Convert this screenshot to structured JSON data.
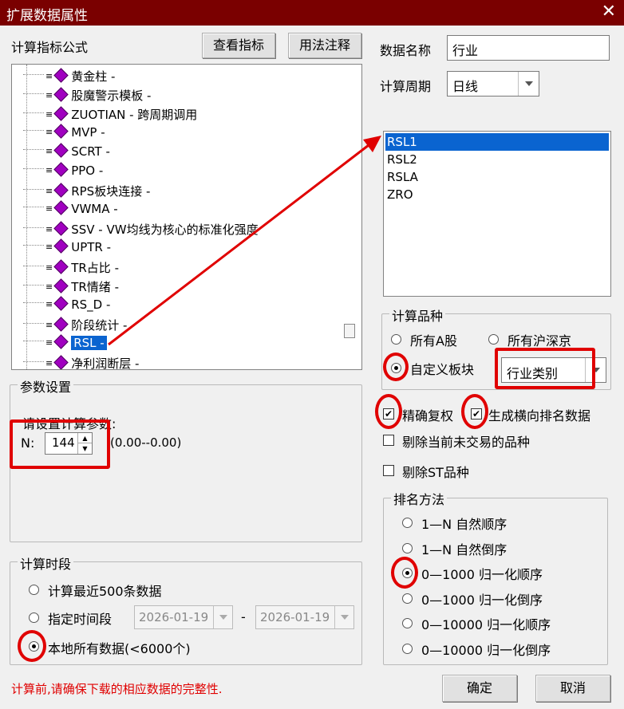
{
  "window": {
    "title": "扩展数据属性",
    "close_glyph": "✕"
  },
  "left": {
    "formula_label": "计算指标公式",
    "view_btn": "查看指标",
    "usage_btn": "用法注释",
    "tree_items": [
      "黄金柱 -",
      "股魔警示模板 -",
      "ZUOTIAN - 跨周期调用",
      "MVP -",
      "SCRT -",
      "PPO -",
      "RPS板块连接 -",
      "VWMA -",
      "SSV - VW均线为核心的标准化强度",
      "UPTR -",
      "TR占比 -",
      "TR情绪 -",
      "RS_D -",
      "阶段统计 -",
      "RSL -",
      "净利润断层 -"
    ],
    "params_group": "参数设置",
    "params_hint": "请设置计算参数:",
    "n_label": "N:",
    "n_value": "144",
    "n_range": "(0.00--0.00)",
    "period_group": "计算时段",
    "opt_recent": "计算最近500条数据",
    "opt_range": "指定时间段",
    "date_from": "2026-01-19",
    "date_to": "2026-01-19",
    "dash": "-",
    "opt_all": "本地所有数据(<6000个)",
    "warning": "计算前,请确保下载的相应数据的完整性."
  },
  "right": {
    "name_label": "数据名称",
    "name_value": "行业",
    "cycle_label": "计算周期",
    "cycle_value": "日线",
    "outputs": [
      "RSL1",
      "RSL2",
      "RSLA",
      "ZRO"
    ],
    "variety_group": "计算品种",
    "opt_all_a": "所有A股",
    "opt_all_hs": "所有沪深京",
    "opt_custom": "自定义板块",
    "custom_value": "行业类别",
    "chk_exact": "精确复权",
    "chk_horizontal": "生成横向排名数据",
    "chk_untraded": "剔除当前未交易的品种",
    "chk_st": "剔除ST品种",
    "rank_group": "排名方法",
    "rank_opts": [
      "1—N 自然顺序",
      "1—N 自然倒序",
      "0—1000 归一化顺序",
      "0—1000 归一化倒序",
      "0—10000 归一化顺序",
      "0—10000 归一化倒序"
    ],
    "ok_btn": "确定",
    "cancel_btn": "取消"
  },
  "colors": {
    "title_bg": "#7a0000",
    "selection": "#0a64d0",
    "annotation": "#e00000",
    "warning": "#e00000"
  }
}
